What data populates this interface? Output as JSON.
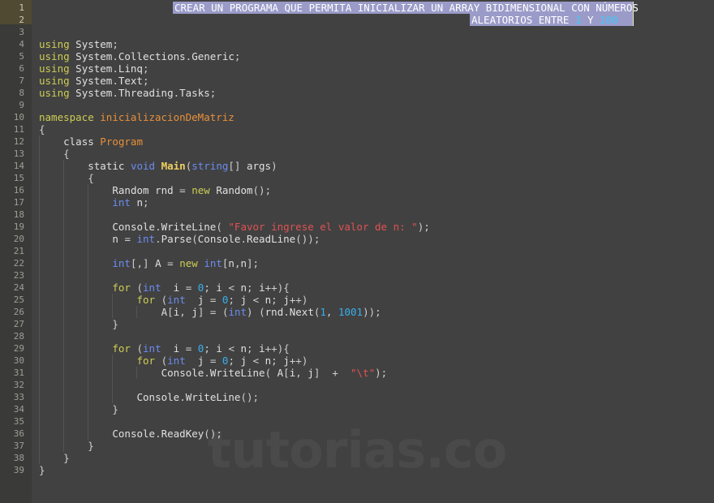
{
  "editor": {
    "name": "code-editor",
    "language": "C#",
    "background_color": "#414141",
    "gutter_color": "#3a3a38",
    "highlight_color": "#4f4a31",
    "selection_color": "#9b9bc9",
    "caret_color": "#e8e6b0",
    "total_lines": 39,
    "line_height": 15
  },
  "watermark": {
    "text": "tutorias.co",
    "color": "#4a4a4a"
  },
  "header_selection": {
    "line1": "CREAR UN PROGRAMA QUE PERMITA INICIALIZAR UN ARRAY BIDIMENSIONAL CON NÚMEROS",
    "line2_prefix": "ALEATORIOS ENTRE ",
    "line2_num1": "1",
    "line2_mid": " Y ",
    "line2_num2": "100",
    "selected": true
  },
  "gutter": {
    "numbers": [
      1,
      2,
      3,
      4,
      5,
      6,
      7,
      8,
      9,
      10,
      11,
      12,
      13,
      14,
      15,
      16,
      17,
      18,
      19,
      20,
      21,
      22,
      23,
      24,
      25,
      26,
      27,
      28,
      29,
      30,
      31,
      32,
      33,
      34,
      35,
      36,
      37,
      38,
      39
    ],
    "highlighted_lines": [
      1,
      2
    ]
  },
  "code_lines": [
    {
      "n": 1,
      "text": ""
    },
    {
      "n": 2,
      "text": ""
    },
    {
      "n": 3,
      "text": ""
    },
    {
      "n": 4,
      "text": "using System;"
    },
    {
      "n": 5,
      "text": "using System.Collections.Generic;"
    },
    {
      "n": 6,
      "text": "using System.Linq;"
    },
    {
      "n": 7,
      "text": "using System.Text;"
    },
    {
      "n": 8,
      "text": "using System.Threading.Tasks;"
    },
    {
      "n": 9,
      "text": ""
    },
    {
      "n": 10,
      "text": "namespace inicializacionDeMatriz"
    },
    {
      "n": 11,
      "text": "{"
    },
    {
      "n": 12,
      "text": "    class Program"
    },
    {
      "n": 13,
      "text": "    {"
    },
    {
      "n": 14,
      "text": "        static void Main(string[] args)"
    },
    {
      "n": 15,
      "text": "        {"
    },
    {
      "n": 16,
      "text": "            Random rnd = new Random();"
    },
    {
      "n": 17,
      "text": "            int n;"
    },
    {
      "n": 18,
      "text": ""
    },
    {
      "n": 19,
      "text": "            Console.WriteLine( \"Favor ingrese el valor de n: \");"
    },
    {
      "n": 20,
      "text": "            n = int.Parse(Console.ReadLine());"
    },
    {
      "n": 21,
      "text": ""
    },
    {
      "n": 22,
      "text": "            int[,] A = new int[n,n];"
    },
    {
      "n": 23,
      "text": ""
    },
    {
      "n": 24,
      "text": "            for (int  i = 0; i < n; i++){"
    },
    {
      "n": 25,
      "text": "                for (int  j = 0; j < n; j++)"
    },
    {
      "n": 26,
      "text": "                    A[i, j] = (int) (rnd.Next(1, 1001));"
    },
    {
      "n": 27,
      "text": "            }"
    },
    {
      "n": 28,
      "text": ""
    },
    {
      "n": 29,
      "text": "            for (int  i = 0; i < n; i++){"
    },
    {
      "n": 30,
      "text": "                for (int  j = 0; j < n; j++)"
    },
    {
      "n": 31,
      "text": "                    Console.WriteLine( A[i, j]  +  \"\\t\");"
    },
    {
      "n": 32,
      "text": ""
    },
    {
      "n": 33,
      "text": "                Console.WriteLine();"
    },
    {
      "n": 34,
      "text": "            }"
    },
    {
      "n": 35,
      "text": ""
    },
    {
      "n": 36,
      "text": "            Console.ReadKey();"
    },
    {
      "n": 37,
      "text": "        }"
    },
    {
      "n": 38,
      "text": "    }"
    },
    {
      "n": 39,
      "text": "}"
    }
  ],
  "syntax_colors": {
    "keyword": "#cdcd55",
    "type": "#6b8cf0",
    "string": "#e05252",
    "number": "#38b0f0",
    "class_name": "#e8903a",
    "function": "#f0d060",
    "plain": "#e0e0e0"
  }
}
